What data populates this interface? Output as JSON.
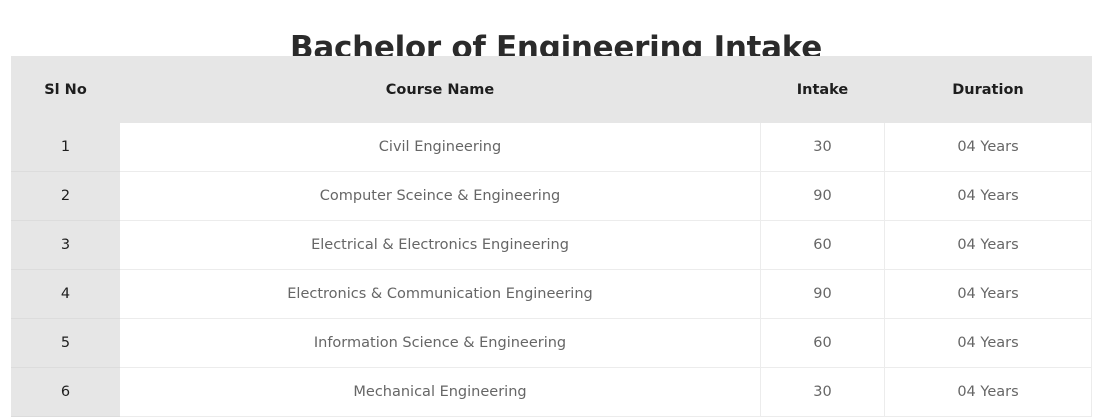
{
  "title": "Bachelor of Engineering Intake",
  "table": {
    "headers": {
      "sl_no": "Sl No",
      "course_name": "Course Name",
      "intake": "Intake",
      "duration": "Duration"
    },
    "rows": [
      {
        "sl_no": "1",
        "course_name": "Civil Engineering",
        "intake": "30",
        "duration": "04 Years"
      },
      {
        "sl_no": "2",
        "course_name": "Computer Sceince & Engineering",
        "intake": "90",
        "duration": "04 Years"
      },
      {
        "sl_no": "3",
        "course_name": "Electrical & Electronics Engineering",
        "intake": "60",
        "duration": "04 Years"
      },
      {
        "sl_no": "4",
        "course_name": "Electronics & Communication Engineering",
        "intake": "90",
        "duration": "04 Years"
      },
      {
        "sl_no": "5",
        "course_name": "Information Science & Engineering",
        "intake": "60",
        "duration": "04 Years"
      },
      {
        "sl_no": "6",
        "course_name": "Mechanical Engineering",
        "intake": "30",
        "duration": "04 Years"
      }
    ]
  },
  "colors": {
    "header_background": "#e6e6e6",
    "title_text": "#2b2b2b",
    "cell_text": "#666666"
  }
}
